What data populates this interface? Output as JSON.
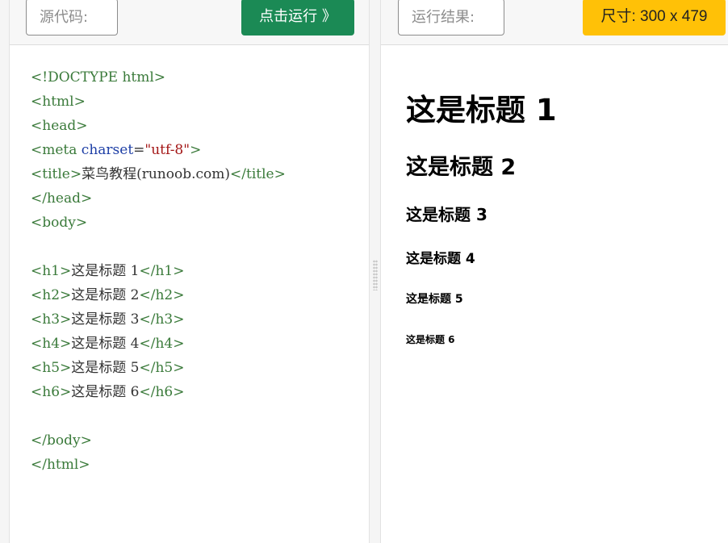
{
  "source_panel": {
    "label": "源代码:",
    "run_button": "点击运行 》"
  },
  "code_lines": [
    [
      {
        "c": "t",
        "v": "<!DOCTYPE html>"
      }
    ],
    [
      {
        "c": "t",
        "v": "<html>"
      }
    ],
    [
      {
        "c": "t",
        "v": "<head>"
      }
    ],
    [
      {
        "c": "t",
        "v": "<meta "
      },
      {
        "c": "a",
        "v": "charset"
      },
      {
        "c": "p",
        "v": "="
      },
      {
        "c": "s",
        "v": "\"utf-8\""
      },
      {
        "c": "t",
        "v": ">"
      }
    ],
    [
      {
        "c": "t",
        "v": "<title>"
      },
      {
        "c": "p",
        "v": "菜鸟教程(runoob.com)"
      },
      {
        "c": "t",
        "v": "</title>"
      }
    ],
    [
      {
        "c": "t",
        "v": "</head>"
      }
    ],
    [
      {
        "c": "t",
        "v": "<body>"
      }
    ],
    [],
    [
      {
        "c": "t",
        "v": "<h1>"
      },
      {
        "c": "p",
        "v": "这是标题 1"
      },
      {
        "c": "t",
        "v": "</h1>"
      }
    ],
    [
      {
        "c": "t",
        "v": "<h2>"
      },
      {
        "c": "p",
        "v": "这是标题 2"
      },
      {
        "c": "t",
        "v": "</h2>"
      }
    ],
    [
      {
        "c": "t",
        "v": "<h3>"
      },
      {
        "c": "p",
        "v": "这是标题 3"
      },
      {
        "c": "t",
        "v": "</h3>"
      }
    ],
    [
      {
        "c": "t",
        "v": "<h4>"
      },
      {
        "c": "p",
        "v": "这是标题 4"
      },
      {
        "c": "t",
        "v": "</h4>"
      }
    ],
    [
      {
        "c": "t",
        "v": "<h5>"
      },
      {
        "c": "p",
        "v": "这是标题 5"
      },
      {
        "c": "t",
        "v": "</h5>"
      }
    ],
    [
      {
        "c": "t",
        "v": "<h6>"
      },
      {
        "c": "p",
        "v": "这是标题 6"
      },
      {
        "c": "t",
        "v": "</h6>"
      }
    ],
    [],
    [
      {
        "c": "t",
        "v": "</body>"
      }
    ],
    [
      {
        "c": "t",
        "v": "</html>"
      }
    ]
  ],
  "result_panel": {
    "label": "运行结果:",
    "size_badge": "尺寸: 300 x 479",
    "headings": [
      "这是标题 1",
      "这是标题 2",
      "这是标题 3",
      "这是标题 4",
      "这是标题 5",
      "这是标题 6"
    ]
  },
  "colors": {
    "run_button": "#1b8a55",
    "size_badge": "#ffc107",
    "tag": "#3a7a3a",
    "attr": "#1e3fa6",
    "string": "#a31515"
  }
}
